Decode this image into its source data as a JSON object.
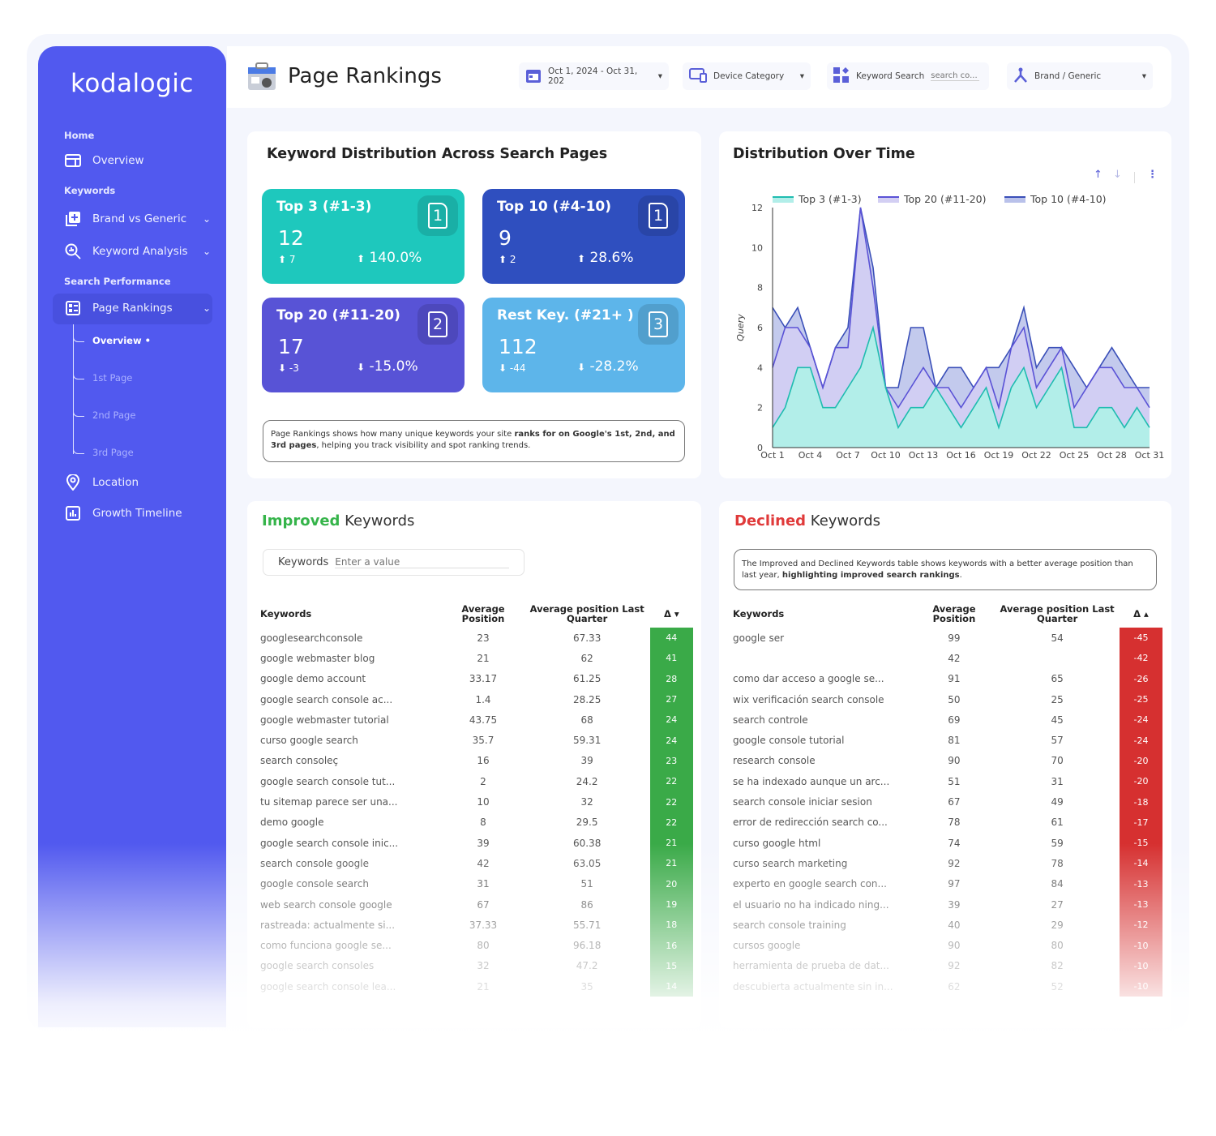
{
  "brand": "kodalogic",
  "sidebar": {
    "sections": [
      "Home",
      "Keywords",
      "Search Performance"
    ],
    "items": [
      {
        "label": "Overview",
        "icon": "dashboard-icon"
      },
      {
        "label": "Brand vs Generic",
        "icon": "add-library-icon"
      },
      {
        "label": "Keyword Analysis",
        "icon": "search-analytics-icon"
      },
      {
        "label": "Page Rankings",
        "icon": "ranking-list-icon"
      },
      {
        "label": "Location",
        "icon": "location-pin-icon"
      },
      {
        "label": "Growth Timeline",
        "icon": "bar-chart-icon"
      }
    ],
    "subitems": [
      "Overview •",
      "1st Page",
      "2nd Page",
      "3rd Page"
    ]
  },
  "header": {
    "title": "Page Rankings",
    "date_range": "Oct 1, 2024 - Oct 31, 202",
    "device": "Device Category",
    "keyword_search_label": "Keyword Search",
    "keyword_search_placeholder": "search co...",
    "brand_filter": "Brand / Generic"
  },
  "distribution": {
    "title": "Keyword Distribution Across Search Pages",
    "cards": [
      {
        "title": "Top 3 (#1-3)",
        "value": "12",
        "delta": "7",
        "pct": "140.0%",
        "page": "1",
        "dir": "up",
        "color": "#1ec8bd"
      },
      {
        "title": "Top 10 (#4-10)",
        "value": "9",
        "delta": "2",
        "pct": "28.6%",
        "page": "1",
        "dir": "up",
        "color": "#2f4fbf"
      },
      {
        "title": "Top 20 (#11-20)",
        "value": "17",
        "delta": "-3",
        "pct": "-15.0%",
        "page": "2",
        "dir": "down",
        "color": "#5853d6"
      },
      {
        "title": "Rest Key. (#21+ )",
        "value": "112",
        "delta": "-44",
        "pct": "-28.2%",
        "page": "3",
        "dir": "down",
        "color": "#5db5ea"
      }
    ],
    "note_pre": "Page Rankings shows how many unique keywords your site ",
    "note_bold": "ranks for on Google's 1st, 2nd, and 3rd pages",
    "note_post": ", helping you track visibility and spot ranking trends."
  },
  "chart_data": {
    "type": "area",
    "title": "Distribution Over Time",
    "ylabel": "Query",
    "xlabel": "",
    "ylim": [
      0,
      12
    ],
    "yticks": [
      0,
      2,
      4,
      6,
      8,
      10,
      12
    ],
    "x": [
      "Oct 1",
      "Oct 2",
      "Oct 3",
      "Oct 4",
      "Oct 5",
      "Oct 6",
      "Oct 7",
      "Oct 8",
      "Oct 9",
      "Oct 10",
      "Oct 11",
      "Oct 12",
      "Oct 13",
      "Oct 14",
      "Oct 15",
      "Oct 16",
      "Oct 17",
      "Oct 18",
      "Oct 19",
      "Oct 20",
      "Oct 21",
      "Oct 22",
      "Oct 23",
      "Oct 24",
      "Oct 25",
      "Oct 26",
      "Oct 27",
      "Oct 28",
      "Oct 29",
      "Oct 30",
      "Oct 31"
    ],
    "xticks": [
      "Oct 1",
      "Oct 4",
      "Oct 7",
      "Oct 10",
      "Oct 13",
      "Oct 16",
      "Oct 19",
      "Oct 22",
      "Oct 25",
      "Oct 28",
      "Oct 31"
    ],
    "legend": "top",
    "series": [
      {
        "name": "Top 10 (#4-10)",
        "color": "#3a4fb8",
        "fill": "#b9c1ea",
        "values": [
          7,
          6,
          7,
          5,
          3,
          5,
          6,
          12,
          9,
          3,
          3,
          6,
          6,
          3,
          4,
          4,
          3,
          4,
          4,
          5,
          7,
          4,
          5,
          5,
          4,
          3,
          4,
          5,
          4,
          3,
          3
        ]
      },
      {
        "name": "Top 20 (#11-20)",
        "color": "#5a52d6",
        "fill": "#d3cff3",
        "values": [
          4,
          6,
          6,
          5,
          3,
          5,
          5,
          12,
          8,
          3,
          2,
          3,
          4,
          3,
          3,
          2,
          3,
          4,
          2,
          5,
          6,
          3,
          4,
          5,
          2,
          3,
          4,
          4,
          3,
          3,
          2
        ]
      },
      {
        "name": "Top 3 (#1-3)",
        "color": "#1fbcb0",
        "fill": "#b2eee9",
        "values": [
          1,
          2,
          4,
          4,
          2,
          2,
          3,
          4,
          6,
          3,
          1,
          2,
          2,
          3,
          2,
          1,
          2,
          3,
          1,
          3,
          4,
          2,
          3,
          4,
          1,
          1,
          2,
          2,
          1,
          2,
          1
        ]
      }
    ]
  },
  "improved": {
    "title_accent": "Improved",
    "title_rest": " Keywords",
    "accent_color": "#35b44a",
    "filter_label": "Keywords",
    "filter_placeholder": "Enter a value",
    "columns": [
      "Keywords",
      "Average Position",
      "Average position Last Quarter",
      "Δ ▾"
    ],
    "rows": [
      [
        "googlesearchconsole",
        "23",
        "67.33",
        "44"
      ],
      [
        "google webmaster blog",
        "21",
        "62",
        "41"
      ],
      [
        "google demo account",
        "33.17",
        "61.25",
        "28"
      ],
      [
        "google search console ac...",
        "1.4",
        "28.25",
        "27"
      ],
      [
        "google webmaster tutorial",
        "43.75",
        "68",
        "24"
      ],
      [
        "curso google search",
        "35.7",
        "59.31",
        "24"
      ],
      [
        "search consoleç",
        "16",
        "39",
        "23"
      ],
      [
        "google search console tut...",
        "2",
        "24.2",
        "22"
      ],
      [
        "tu sitemap parece ser una...",
        "10",
        "32",
        "22"
      ],
      [
        "demo google",
        "8",
        "29.5",
        "22"
      ],
      [
        "google search console inic...",
        "39",
        "60.38",
        "21"
      ],
      [
        "search console google",
        "42",
        "63.05",
        "21"
      ],
      [
        "google console search",
        "31",
        "51",
        "20"
      ],
      [
        "web search console google",
        "67",
        "86",
        "19"
      ],
      [
        "rastreada: actualmente si...",
        "37.33",
        "55.71",
        "18"
      ],
      [
        "como funciona google se...",
        "80",
        "96.18",
        "16"
      ],
      [
        "google search consoles",
        "32",
        "47.2",
        "15"
      ],
      [
        "google search console lea...",
        "21",
        "35",
        "14"
      ]
    ]
  },
  "declined": {
    "title_accent": "Declined",
    "title_rest": " Keywords",
    "accent_color": "#e03a3a",
    "note_pre": "The Improved and Declined Keywords table shows keywords with a better average position than last year, ",
    "note_bold": "highlighting improved search rankings",
    "note_post": ".",
    "columns": [
      "Keywords",
      "Average Position",
      "Average position Last Quarter",
      "Δ ▴"
    ],
    "rows": [
      [
        "google ser",
        "99",
        "54",
        "-45"
      ],
      [
        "",
        "42",
        "",
        "-42"
      ],
      [
        "como dar acceso a google se...",
        "91",
        "65",
        "-26"
      ],
      [
        "wix verificación search console",
        "50",
        "25",
        "-25"
      ],
      [
        "search controle",
        "69",
        "45",
        "-24"
      ],
      [
        "google console tutorial",
        "81",
        "57",
        "-24"
      ],
      [
        "research console",
        "90",
        "70",
        "-20"
      ],
      [
        "se ha indexado aunque un arc...",
        "51",
        "31",
        "-20"
      ],
      [
        "search console iniciar sesion",
        "67",
        "49",
        "-18"
      ],
      [
        "error de redirección search co...",
        "78",
        "61",
        "-17"
      ],
      [
        "curso google html",
        "74",
        "59",
        "-15"
      ],
      [
        "curso search marketing",
        "92",
        "78",
        "-14"
      ],
      [
        "experto en google search con...",
        "97",
        "84",
        "-13"
      ],
      [
        "el usuario no ha indicado ning...",
        "39",
        "27",
        "-13"
      ],
      [
        "search console training",
        "40",
        "29",
        "-12"
      ],
      [
        "cursos google",
        "90",
        "80",
        "-10"
      ],
      [
        "herramienta de prueba de dat...",
        "92",
        "82",
        "-10"
      ],
      [
        "descubierta actualmente sin in...",
        "62",
        "52",
        "-10"
      ]
    ]
  }
}
